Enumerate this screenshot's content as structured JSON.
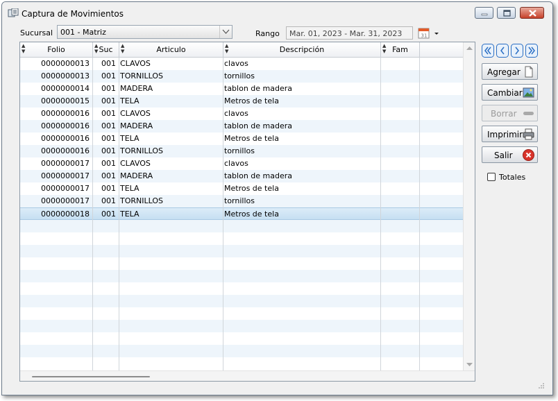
{
  "window": {
    "title": "Captura de Movimientos"
  },
  "filters": {
    "sucursal_label": "Sucursal",
    "sucursal_value": "001 - Matriz",
    "rango_label": "Rango",
    "rango_value": "Mar. 01, 2023 - Mar. 31, 2023"
  },
  "table": {
    "columns": [
      "Folio",
      "Suc",
      "Articulo",
      "Descripción",
      "Fam"
    ],
    "rows": [
      [
        "0000000013",
        "001",
        "CLAVOS",
        "clavos",
        ""
      ],
      [
        "0000000013",
        "001",
        "TORNILLOS",
        "tornillos",
        ""
      ],
      [
        "0000000014",
        "001",
        "MADERA",
        "tablon de madera",
        ""
      ],
      [
        "0000000015",
        "001",
        "TELA",
        "Metros de tela",
        ""
      ],
      [
        "0000000016",
        "001",
        "CLAVOS",
        "clavos",
        ""
      ],
      [
        "0000000016",
        "001",
        "MADERA",
        "tablon de madera",
        ""
      ],
      [
        "0000000016",
        "001",
        "TELA",
        "Metros de tela",
        ""
      ],
      [
        "0000000016",
        "001",
        "TORNILLOS",
        "tornillos",
        ""
      ],
      [
        "0000000017",
        "001",
        "CLAVOS",
        "clavos",
        ""
      ],
      [
        "0000000017",
        "001",
        "MADERA",
        "tablon de madera",
        ""
      ],
      [
        "0000000017",
        "001",
        "TELA",
        "Metros de tela",
        ""
      ],
      [
        "0000000017",
        "001",
        "TORNILLOS",
        "tornillos",
        ""
      ],
      [
        "0000000018",
        "001",
        "TELA",
        "Metros de tela",
        ""
      ]
    ],
    "selected_row": 12
  },
  "actions": {
    "agregar": "Agregar",
    "cambiar": "Cambiar",
    "borrar": "Borrar",
    "imprimir": "Imprimir",
    "salir": "Salir",
    "totales": "Totales"
  },
  "icons": {
    "app": "movements-icon",
    "calendar": "calendar-icon",
    "nav": [
      "first-page-icon",
      "prev-page-icon",
      "next-page-icon",
      "last-page-icon"
    ]
  },
  "colors": {
    "selected_row": "#c6dff2",
    "alt_row": "#eef5fb",
    "close_button": "#c6412a",
    "salir_icon": "#d9342b"
  }
}
